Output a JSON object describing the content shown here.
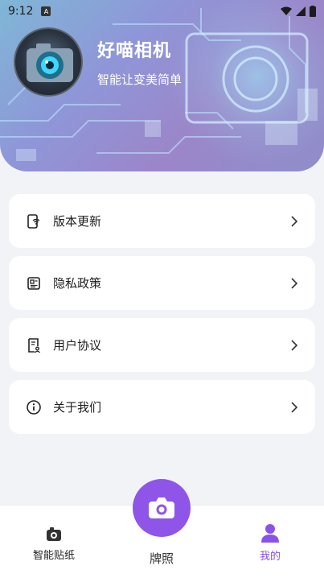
{
  "status_bar": {
    "time": "9:12",
    "sim_badge": "A"
  },
  "profile": {
    "app_name": "好喵相机",
    "tagline": "智能让变美简单"
  },
  "menu": {
    "items": [
      {
        "label": "版本更新",
        "icon": "phone-update-icon"
      },
      {
        "label": "隐私政策",
        "icon": "id-card-icon"
      },
      {
        "label": "用户协议",
        "icon": "document-user-icon"
      },
      {
        "label": "关于我们",
        "icon": "info-circle-icon"
      }
    ]
  },
  "bottom_nav": {
    "left_label": "智能贴纸",
    "center_label": "牌照",
    "right_label": "我的",
    "active": "我的"
  },
  "colors": {
    "accent": "#8f55e9",
    "active_tab": "#8a52e8",
    "background": "#f2f3f7"
  }
}
